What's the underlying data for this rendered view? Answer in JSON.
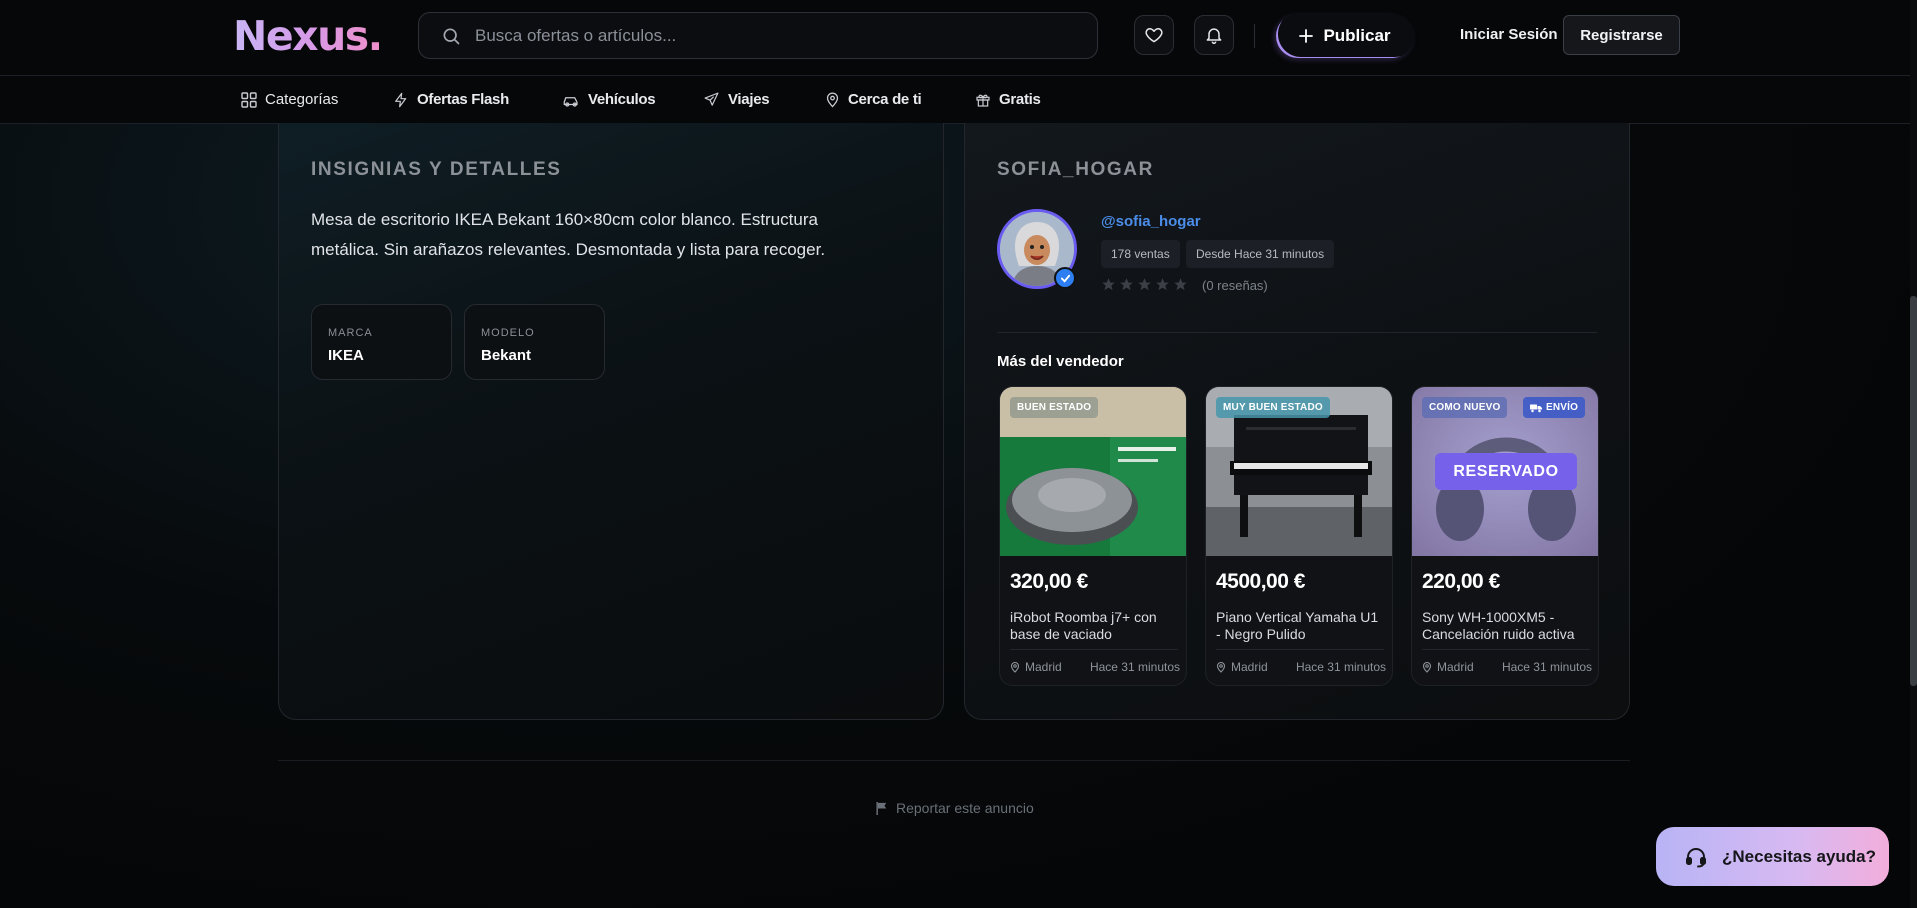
{
  "header": {
    "logo": "Nexus.",
    "search_placeholder": "Busca ofertas o artículos...",
    "publish_label": "Publicar",
    "login_label": "Iniciar Sesión",
    "register_label": "Registrarse"
  },
  "nav": {
    "items": [
      {
        "label": "Categorías",
        "icon": "grid-icon"
      },
      {
        "label": "Ofertas Flash",
        "icon": "lightning-icon"
      },
      {
        "label": "Vehículos",
        "icon": "car-icon"
      },
      {
        "label": "Viajes",
        "icon": "plane-icon"
      },
      {
        "label": "Cerca de ti",
        "icon": "map-pin-icon"
      },
      {
        "label": "Gratis",
        "icon": "gift-icon"
      }
    ]
  },
  "details": {
    "heading": "INSIGNIAS Y DETALLES",
    "description": "Mesa de escritorio IKEA Bekant 160×80cm color blanco. Estructura metálica. Sin arañazos relevantes. Desmontada y lista para recoger.",
    "specs": [
      {
        "label": "MARCA",
        "value": "IKEA"
      },
      {
        "label": "MODELO",
        "value": "Bekant"
      }
    ]
  },
  "seller": {
    "heading": "SOFIA_HOGAR",
    "handle": "@sofia_hogar",
    "sales": "178 ventas",
    "since": "Desde Hace 31 minutos",
    "rating": 0,
    "reviews": "(0 reseñas)",
    "more_title": "Más del vendedor",
    "products": [
      {
        "badge": "BUEN ESTADO",
        "price": "320,00 €",
        "title": "iRobot Roomba j7+ con base de vaciado",
        "location": "Madrid",
        "time": "Hace 31 minutos"
      },
      {
        "badge": "MUY BUEN ESTADO",
        "price": "4500,00 €",
        "title": "Piano Vertical Yamaha U1 - Negro Pulido",
        "location": "Madrid",
        "time": "Hace 31 minutos"
      },
      {
        "badge": "COMO NUEVO",
        "badge2": "ENVÍO",
        "overlay": "RESERVADO",
        "price": "220,00 €",
        "title": "Sony WH-1000XM5 - Cancelación ruido activa",
        "location": "Madrid",
        "time": "Hace 31 minutos"
      }
    ]
  },
  "footer": {
    "report_label": "Reportar este anuncio",
    "help_label": "¿Necesitas ayuda?"
  },
  "colors": {
    "accent": "#7561ea",
    "link": "#4b8de8",
    "background": "#050607"
  }
}
